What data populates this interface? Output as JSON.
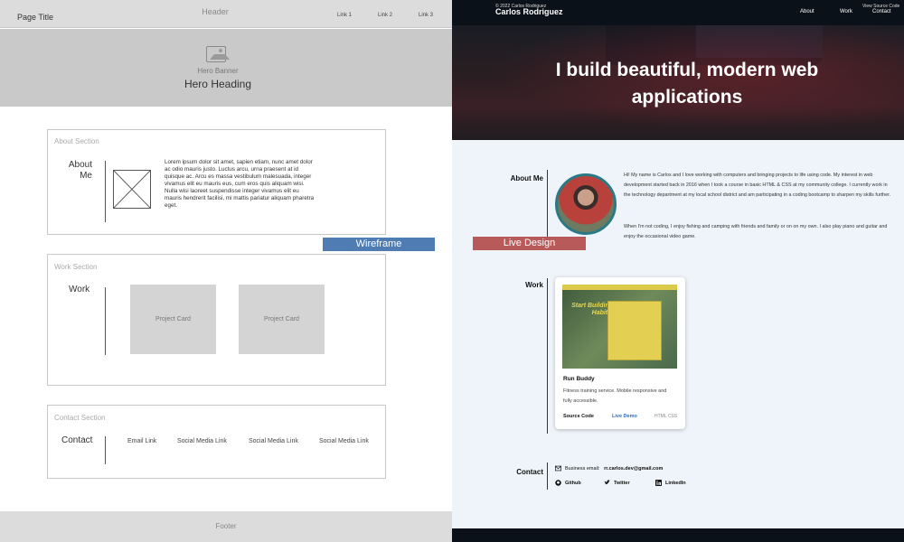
{
  "wireframe": {
    "header_label": "Header",
    "page_title": "Page Title",
    "links": [
      "Link 1",
      "Link 2",
      "Link 3"
    ],
    "hero_sub": "Hero Banner",
    "hero_heading": "Hero Heading",
    "about": {
      "section_label": "About Section",
      "title_line1": "About",
      "title_line2": "Me",
      "text": "Lorem ipsum dolor sit amet, sapien etiam, nunc amet dolor ac odio mauris justo. Luctus arcu, urna praesent at id quisque ac. Arcu es massa vestibulum malesuada, integer vivamus elit eu mauris eus, cum eros quis aliquam wisi. Nulla wisi laoreet suspendisse integer vivamus elit eu mauris hendrerit facilisi, mi mattis pariatur aliquam pharetra eget."
    },
    "work": {
      "section_label": "Work Section",
      "title": "Work",
      "cards": [
        "Project Card",
        "Project Card"
      ]
    },
    "contact": {
      "section_label": "Contact Section",
      "title": "Contact",
      "links": [
        "Email Link",
        "Social Media Link",
        "Social Media Link",
        "Social Media Link"
      ]
    },
    "footer": "Footer",
    "tag": "Wireframe"
  },
  "live": {
    "brand": "Carlos Rodriguez",
    "nav": [
      "About",
      "Work",
      "Contact"
    ],
    "hero_heading_line1": "I build beautiful, modern web",
    "hero_heading_line2": "applications",
    "about": {
      "title": "About Me",
      "p1": "Hi! My name is Carlos and I love working with computers and bringing projects to life using code. My interest in web development started back in 2016 when I took a course in basic HTML & CSS at my community college. I currently work in the technology department at my local school district and am participating in a coding bootcamp to sharpen my skills further.",
      "p2": "When I'm not coding, I enjoy fishing and camping with friends and family or on on my own. I also play piano and guitar and enjoy the occasional video game."
    },
    "work": {
      "title": "Work",
      "project": {
        "image_title": "Start Building Habits.",
        "name": "Run Buddy",
        "desc": "Fitness training service. Mobile responsive and fully accessible.",
        "source": "Source Code",
        "demo": "Live Demo",
        "tags": "HTML  CSS"
      }
    },
    "contact": {
      "title": "Contact",
      "email_label": "Business email:",
      "email": "rr.carlos.dev@gmail.com",
      "github": "Github",
      "twitter": "Twitter",
      "linkedin": "LinkedIn"
    },
    "footer_left": "© 2022 Carlos Rodriguez",
    "footer_right": "View Source Code",
    "tag": "Live Design"
  }
}
